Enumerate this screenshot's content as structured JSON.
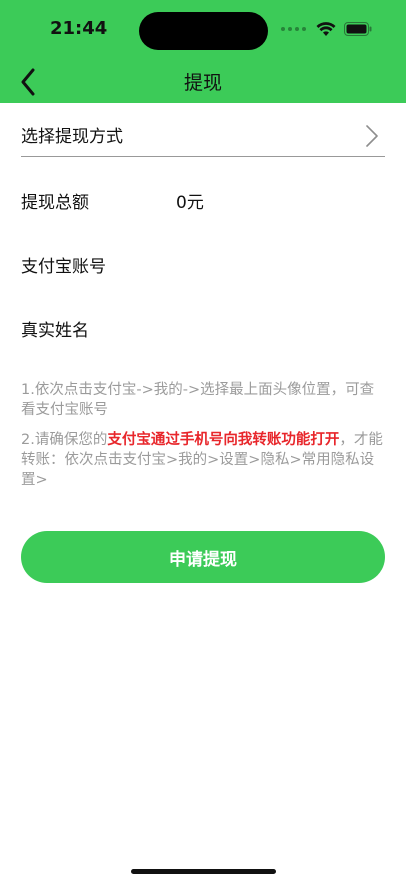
{
  "status_bar": {
    "time": "21:44"
  },
  "nav": {
    "title": "提现"
  },
  "form": {
    "method_label": "选择提现方式",
    "total_label": "提现总额",
    "total_value": "0元",
    "alipay_label": "支付宝账号",
    "alipay_value": "",
    "name_label": "真实姓名",
    "name_value": ""
  },
  "notes": {
    "note1": "1.依次点击支付宝->我的->选择最上面头像位置，可查看支付宝账号",
    "note2_prefix": "2.请确保您的",
    "note2_highlight": "支付宝通过手机号向我转账功能打开",
    "note2_suffix": "，才能转账：依次点击支付宝>我的>设置>隐私>常用隐私设置>"
  },
  "actions": {
    "submit_label": "申请提现"
  },
  "colors": {
    "brand_green": "#3ccb58",
    "warning_red": "#e8262b",
    "note_gray": "#9b9b9b"
  },
  "icons": {
    "back": "chevron-left-icon",
    "method_arrow": "chevron-right-icon",
    "wifi": "wifi-icon",
    "battery": "battery-icon"
  }
}
